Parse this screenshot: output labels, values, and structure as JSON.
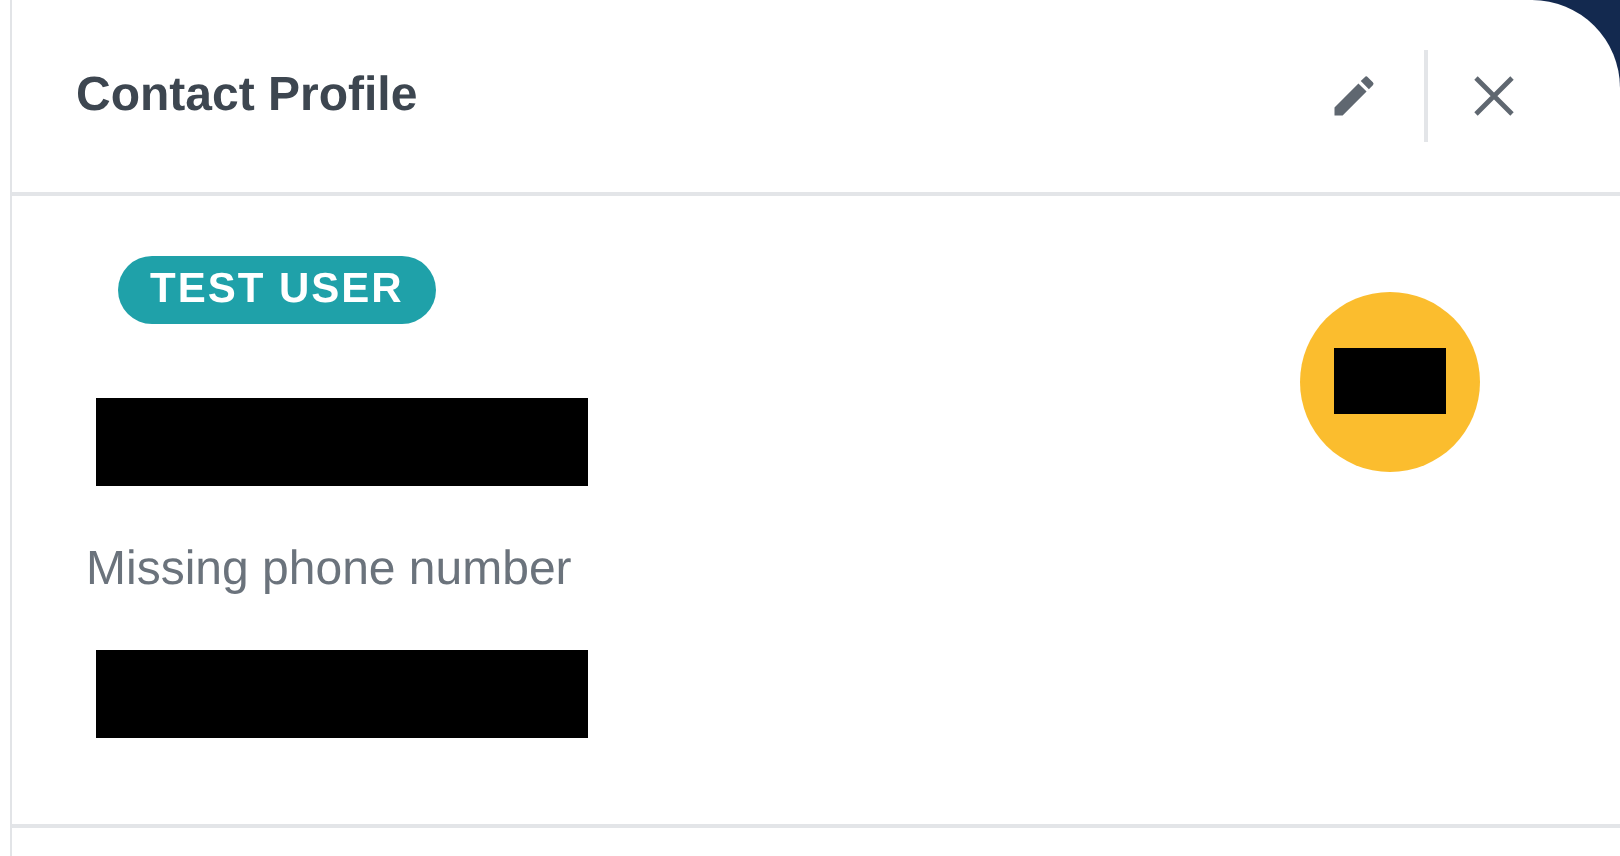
{
  "header": {
    "title": "Contact Profile"
  },
  "badge": {
    "label": "TEST USER"
  },
  "fields": [
    {
      "kind": "redacted"
    },
    {
      "kind": "text",
      "text": "Missing phone number"
    },
    {
      "kind": "redacted"
    }
  ]
}
